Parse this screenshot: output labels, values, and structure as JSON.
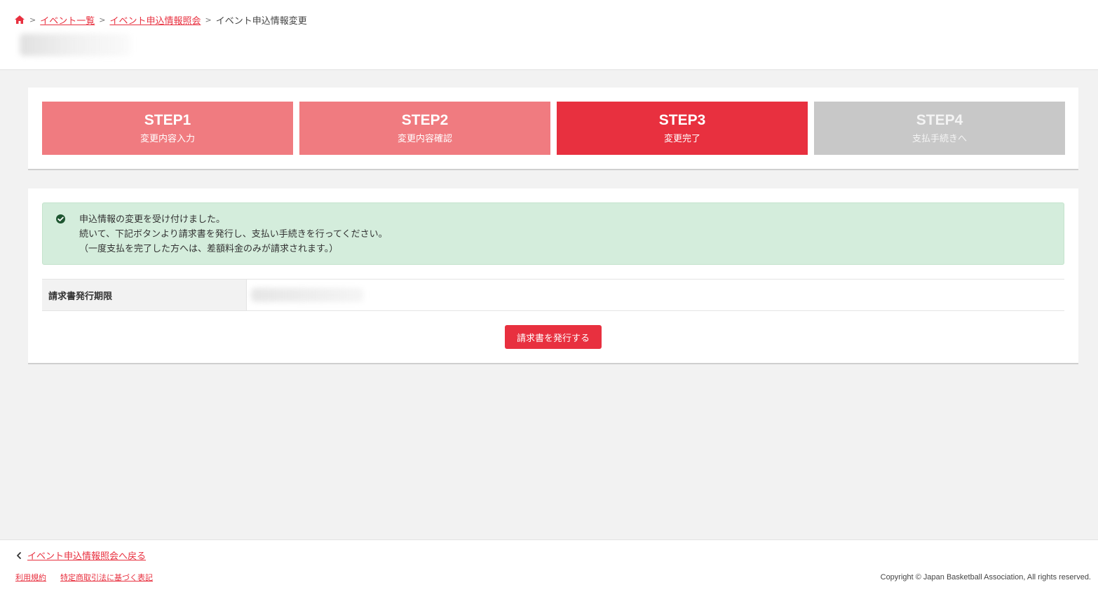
{
  "breadcrumb": {
    "items": [
      {
        "label": "イベント一覧"
      },
      {
        "label": "イベント申込情報照会"
      }
    ],
    "current": "イベント申込情報変更"
  },
  "steps": [
    {
      "num": "STEP1",
      "label": "変更内容入力",
      "state": "done"
    },
    {
      "num": "STEP2",
      "label": "変更内容確認",
      "state": "done"
    },
    {
      "num": "STEP3",
      "label": "変更完了",
      "state": "active"
    },
    {
      "num": "STEP4",
      "label": "支払手続きへ",
      "state": "todo"
    }
  ],
  "alert": {
    "icon": "check-circle-icon",
    "lines": [
      "申込情報の変更を受け付けました。",
      "続いて、下記ボタンより請求書を発行し、支払い手続きを行ってください。",
      "（一度支払を完了した方へは、差額料金のみが請求されます。）"
    ]
  },
  "info": {
    "label": "請求書発行期限"
  },
  "issue_button": "請求書を発行する",
  "footer": {
    "back_link": "イベント申込情報照会へ戻る",
    "links": [
      "利用規約",
      "特定商取引法に基づく表記"
    ],
    "copyright": "Copyright © Japan Basketball Association, All rights reserved."
  },
  "colors": {
    "accent": "#e8303f",
    "step_done": "#f07b80",
    "step_todo": "#c8c8c8",
    "alert_bg": "#d4eddc",
    "check_icon": "#1e5631"
  }
}
